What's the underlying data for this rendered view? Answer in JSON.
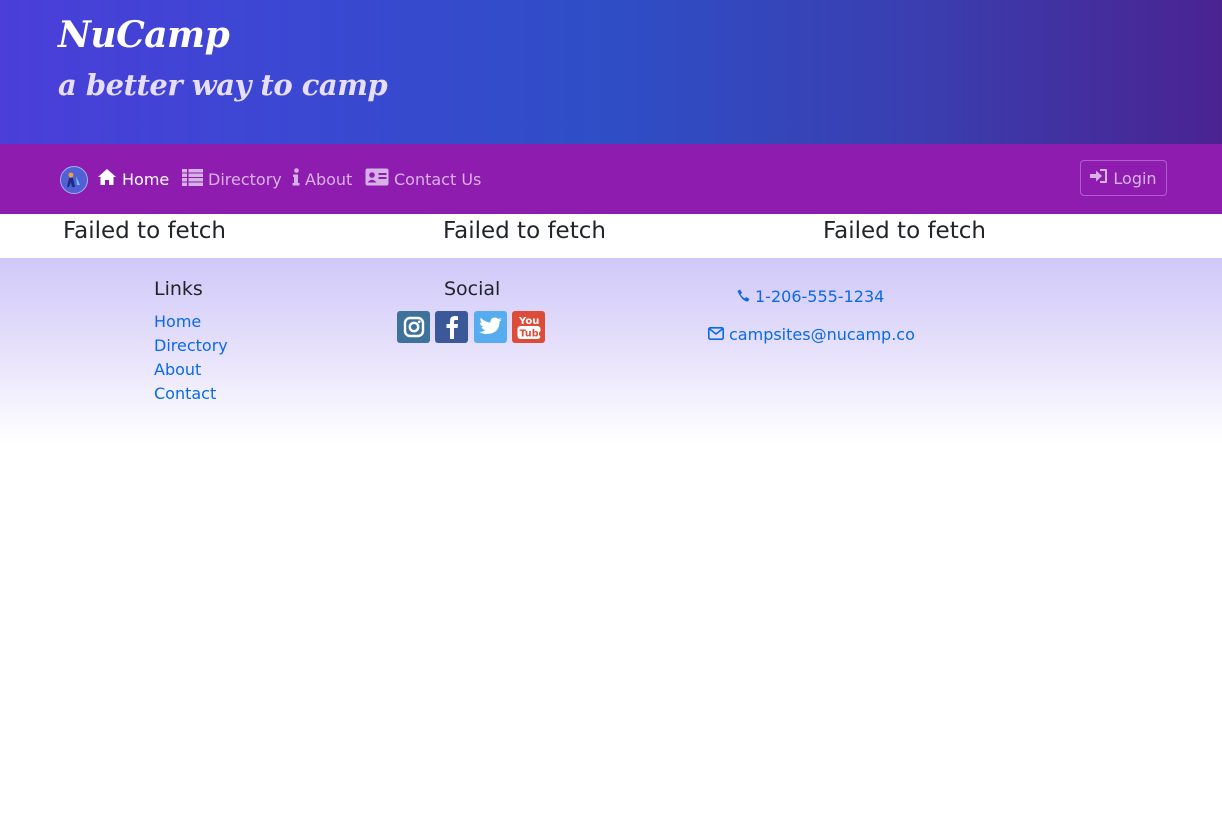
{
  "brand": {
    "title": "NuCamp",
    "tagline": "a better way to camp"
  },
  "nav": {
    "items": [
      {
        "label": "Home",
        "icon": "home-icon",
        "active": true
      },
      {
        "label": "Directory",
        "icon": "list-icon",
        "active": false
      },
      {
        "label": "About",
        "icon": "info-icon",
        "active": false
      },
      {
        "label": "Contact Us",
        "icon": "address-card-icon",
        "active": false
      }
    ],
    "login_label": "Login"
  },
  "main": {
    "errors": [
      "Failed to fetch",
      "Failed to fetch",
      "Failed to fetch"
    ]
  },
  "footer": {
    "links_heading": "Links",
    "links": [
      "Home",
      "Directory",
      "About",
      "Contact"
    ],
    "social_heading": "Social",
    "social": [
      "instagram-icon",
      "facebook-icon",
      "twitter-icon",
      "youtube-icon"
    ],
    "phone": "1-206-555-1234",
    "email": "campsites@nucamp.co"
  },
  "colors": {
    "navbar": "#8e1cae",
    "link": "#0a6ae8",
    "facebook": "#3b5998",
    "twitter": "#55acee",
    "youtube": "#dd4b39",
    "instagram": "#3f729b"
  }
}
